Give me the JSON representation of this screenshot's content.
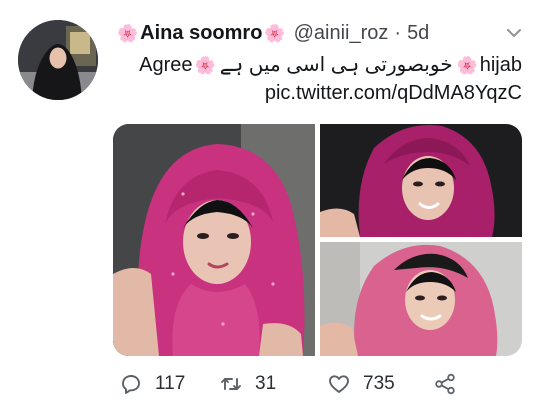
{
  "tweet": {
    "author": {
      "display_name": "Aina soomro",
      "name_emoji_left": "🌸",
      "name_emoji_right": "🌸",
      "handle": "@ainii_roz",
      "separator": "·",
      "timestamp": "5d",
      "avatar_caption": "ainii_roz"
    },
    "text": {
      "word_en_1": "Agree",
      "emoji_1": "🌸",
      "urdu": "خوبصورتی ہی اسی میں ہے",
      "emoji_2": "🌸",
      "word_en_2": "hijab",
      "link": "pic.twitter.com/qDdMA8YqzC"
    },
    "menu_icon": "chevron-down-icon",
    "actions": {
      "reply": {
        "icon": "reply-icon",
        "count": "117"
      },
      "retweet": {
        "icon": "retweet-icon",
        "count": "31"
      },
      "like": {
        "icon": "heart-icon",
        "count": "735"
      },
      "share": {
        "icon": "share-icon"
      }
    },
    "colors": {
      "hijab_pink": "#c8327e",
      "hijab_light_pink": "#d9628f",
      "icon_gray": "#5b6168",
      "text_dark": "#14171a"
    }
  }
}
